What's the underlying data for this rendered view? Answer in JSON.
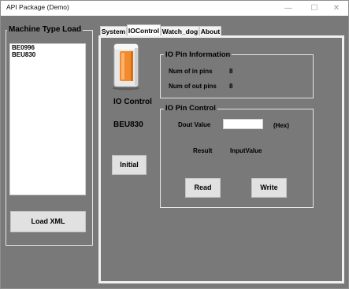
{
  "window": {
    "title": "API Package (Demo)",
    "minimize_glyph": "—",
    "maximize_glyph": "☐",
    "close_glyph": "✕"
  },
  "machine_group": {
    "title": "Machine Type Load",
    "items": [
      {
        "label": "BE0996"
      },
      {
        "label": "BEU830"
      }
    ],
    "load_button": "Load XML"
  },
  "tabs": [
    {
      "label": "System"
    },
    {
      "label": "IOControl"
    },
    {
      "label": "Watch_dog"
    },
    {
      "label": "About"
    }
  ],
  "io_panel": {
    "title": "IO Control",
    "model": "BEU830",
    "initial_button": "Initial",
    "icon": "io-module-icon"
  },
  "io_info": {
    "title": "IO Pin Information",
    "in_label": "Num of in pins",
    "in_value": "8",
    "out_label": "Num of out pins",
    "out_value": "8"
  },
  "io_control": {
    "title": "IO Pin Control",
    "dout_label": "Dout Value",
    "dout_value": "",
    "hex_label": "(Hex)",
    "result_label": "Result",
    "input_label": "InputValue",
    "read_button": "Read",
    "write_button": "Write"
  },
  "colors": {
    "client_bg": "#797979",
    "accent_orange": "#f28a2e"
  }
}
